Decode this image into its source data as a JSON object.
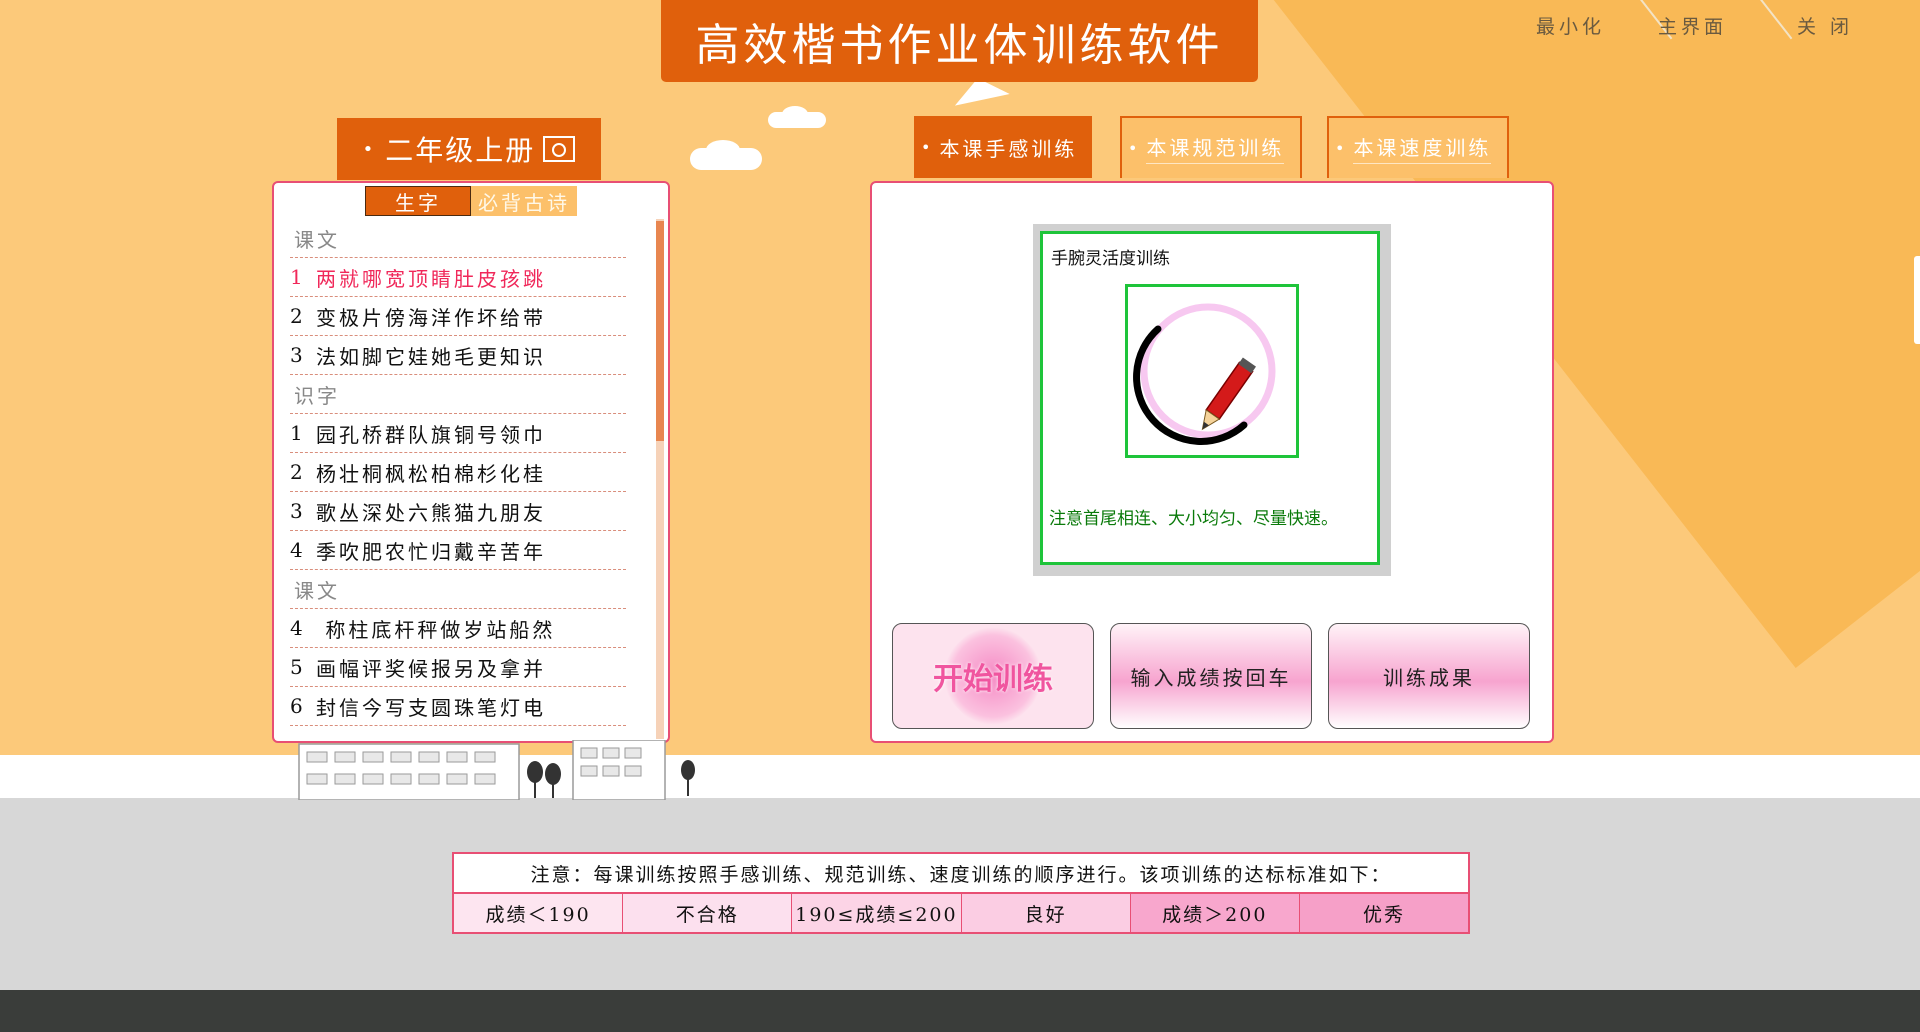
{
  "app": {
    "title": "高效楷书作业体训练软件"
  },
  "window_controls": {
    "minimize": "最小化",
    "main": "主界面",
    "close": "关 闭"
  },
  "sidebar": {
    "grade": "二年级上册",
    "subtabs": [
      "生字",
      "必背古诗"
    ],
    "rows": [
      {
        "type": "head",
        "text": "课文"
      },
      {
        "type": "item",
        "num": "1",
        "text": "两就哪宽顶睛肚皮孩跳",
        "highlight": true
      },
      {
        "type": "item",
        "num": "2",
        "text": "变极片傍海洋作坏给带"
      },
      {
        "type": "item",
        "num": "3",
        "text": "法如脚它娃她毛更知识"
      },
      {
        "type": "head",
        "text": "识字"
      },
      {
        "type": "item",
        "num": "1",
        "text": "园孔桥群队旗铜号领巾"
      },
      {
        "type": "item",
        "num": "2",
        "text": "杨壮桐枫松柏棉杉化桂"
      },
      {
        "type": "item",
        "num": "3",
        "text": "歌丛深处六熊猫九朋友"
      },
      {
        "type": "item",
        "num": "4",
        "text": "季吹肥农忙归戴辛苦年"
      },
      {
        "type": "head",
        "text": "课文"
      },
      {
        "type": "item",
        "num": "4",
        "text": " 称柱底杆秤做岁站船然"
      },
      {
        "type": "item",
        "num": "5",
        "text": "画幅评奖候报另及拿并"
      },
      {
        "type": "item",
        "num": "6",
        "text": "封信今写支圆珠笔灯电"
      }
    ]
  },
  "tabs": [
    "本课手感训练",
    "本课规范训练",
    "本课速度训练"
  ],
  "training": {
    "title": "手腕灵活度训练",
    "note": "注意首尾相连、大小均匀、尽量快速。"
  },
  "buttons": {
    "start": "开始训练",
    "input": "输入成绩按回车",
    "results": "训练成果"
  },
  "standards": {
    "heading": "注意：每课训练按照手感训练、规范训练、速度训练的顺序进行。该项训练的达标标准如下：",
    "cells": [
      "成绩＜190",
      "不合格",
      "190≤成绩≤200",
      "良好",
      "成绩＞200",
      "优秀"
    ]
  }
}
